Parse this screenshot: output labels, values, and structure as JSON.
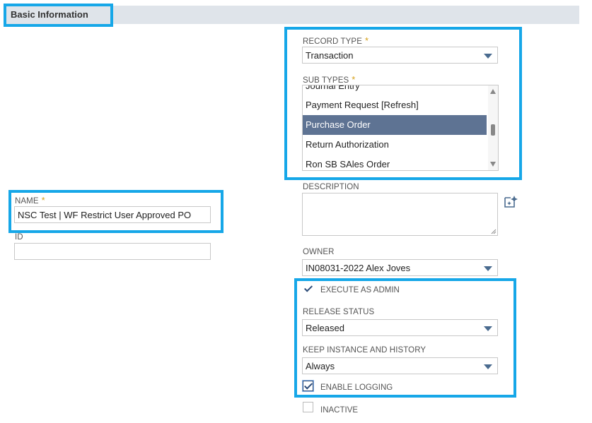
{
  "section": {
    "title": "Basic Information"
  },
  "record_type": {
    "label": "RECORD TYPE",
    "required_mark": "*",
    "value": "Transaction"
  },
  "sub_types": {
    "label": "SUB TYPES",
    "required_mark": "*",
    "options": [
      "Journal Entry",
      "Payment Request [Refresh]",
      "Purchase Order",
      "Return Authorization",
      "Ron SB SAles Order"
    ],
    "selected": "Purchase Order"
  },
  "description": {
    "label": "DESCRIPTION",
    "value": ""
  },
  "name": {
    "label": "NAME",
    "required_mark": "*",
    "value": "NSC Test | WF Restrict User Approved PO"
  },
  "id_field": {
    "label": "ID",
    "value": ""
  },
  "owner": {
    "label": "OWNER",
    "value": "IN08031-2022 Alex Joves"
  },
  "execute_as_admin": {
    "label": "EXECUTE AS ADMIN",
    "checked": true
  },
  "release_status": {
    "label": "RELEASE STATUS",
    "value": "Released"
  },
  "keep_instance": {
    "label": "KEEP INSTANCE AND HISTORY",
    "value": "Always"
  },
  "enable_logging": {
    "label": "ENABLE LOGGING",
    "checked": true
  },
  "inactive": {
    "label": "INACTIVE",
    "checked": false
  },
  "colors": {
    "highlight": "#16a7e8",
    "selected_option": "#5e7393",
    "required": "#d6a019"
  }
}
